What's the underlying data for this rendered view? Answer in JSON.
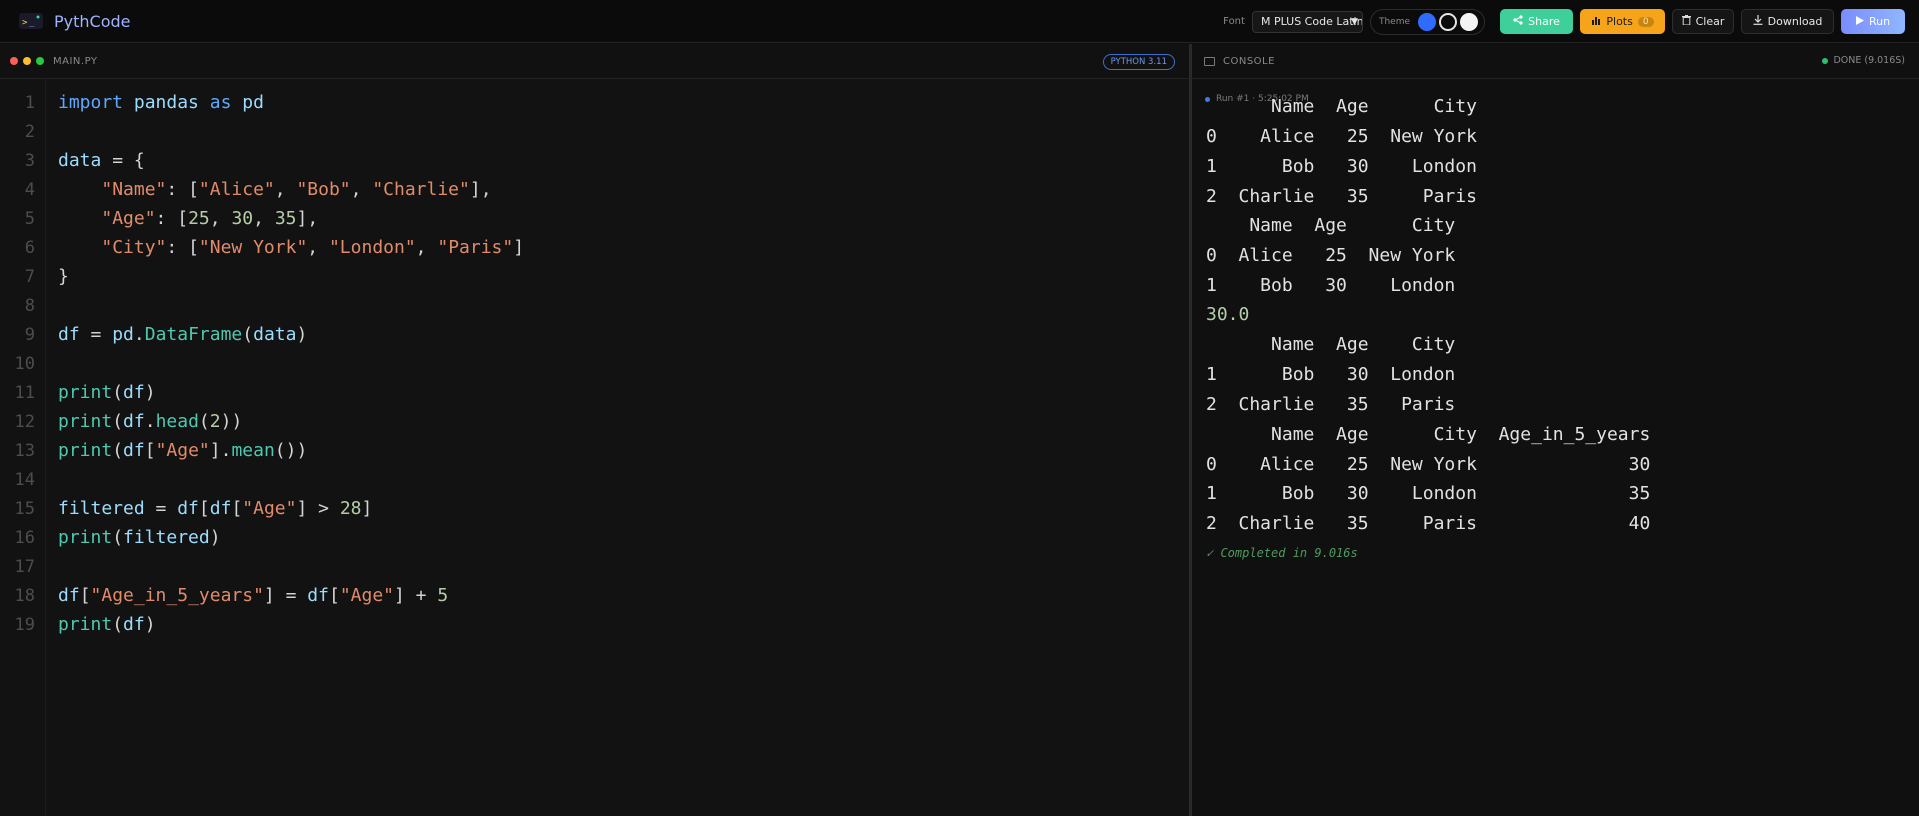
{
  "app": {
    "title": "PythCode"
  },
  "toolbar": {
    "font_label": "Font",
    "font_value": "M PLUS Code Latin",
    "theme_label": "Theme",
    "share_label": "Share",
    "plots_label": "Plots",
    "plots_count": "0",
    "clear_label": "Clear",
    "download_label": "Download",
    "run_label": "Run"
  },
  "editor": {
    "file_name": "MAIN.PY",
    "language_badge": "PYTHON 3.11",
    "line_numbers": [
      "1",
      "2",
      "3",
      "4",
      "5",
      "6",
      "7",
      "8",
      "9",
      "10",
      "11",
      "12",
      "13",
      "14",
      "15",
      "16",
      "17",
      "18",
      "19"
    ],
    "lines": [
      "import pandas as pd",
      "",
      "data = {",
      "    \"Name\": [\"Alice\", \"Bob\", \"Charlie\"],",
      "    \"Age\": [25, 30, 35],",
      "    \"City\": [\"New York\", \"London\", \"Paris\"]",
      "}",
      "",
      "df = pd.DataFrame(data)",
      "",
      "print(df)",
      "print(df.head(2))",
      "print(df[\"Age\"].mean())",
      "",
      "filtered = df[df[\"Age\"] > 28]",
      "print(filtered)",
      "",
      "df[\"Age_in_5_years\"] = df[\"Age\"] + 5",
      "print(df)"
    ]
  },
  "console": {
    "title": "CONSOLE",
    "status": "DONE (9.016S)",
    "run_meta": "Run #1 · 5:25:02 PM",
    "output": [
      "      Name  Age      City",
      "0    Alice   25  New York",
      "1      Bob   30    London",
      "2  Charlie   35     Paris",
      "    Name  Age      City",
      "0  Alice   25  New York",
      "1    Bob   30    London",
      "30.0",
      "      Name  Age    City",
      "1      Bob   30  London",
      "2  Charlie   35   Paris",
      "      Name  Age      City  Age_in_5_years",
      "0    Alice   25  New York              30",
      "1      Bob   30    London              35",
      "2  Charlie   35     Paris              40"
    ],
    "completed": "✓ Completed in 9.016s"
  },
  "colors": {
    "accent": "#9fb3ff",
    "share": "#3ecf9b",
    "plots": "#f6a51b",
    "run": "#8fb7ff",
    "status_ok": "#2fbf71"
  },
  "icons": [
    "logo-icon",
    "share-icon",
    "bar-chart-icon",
    "trash-icon",
    "download-icon",
    "play-icon",
    "terminal-icon"
  ]
}
